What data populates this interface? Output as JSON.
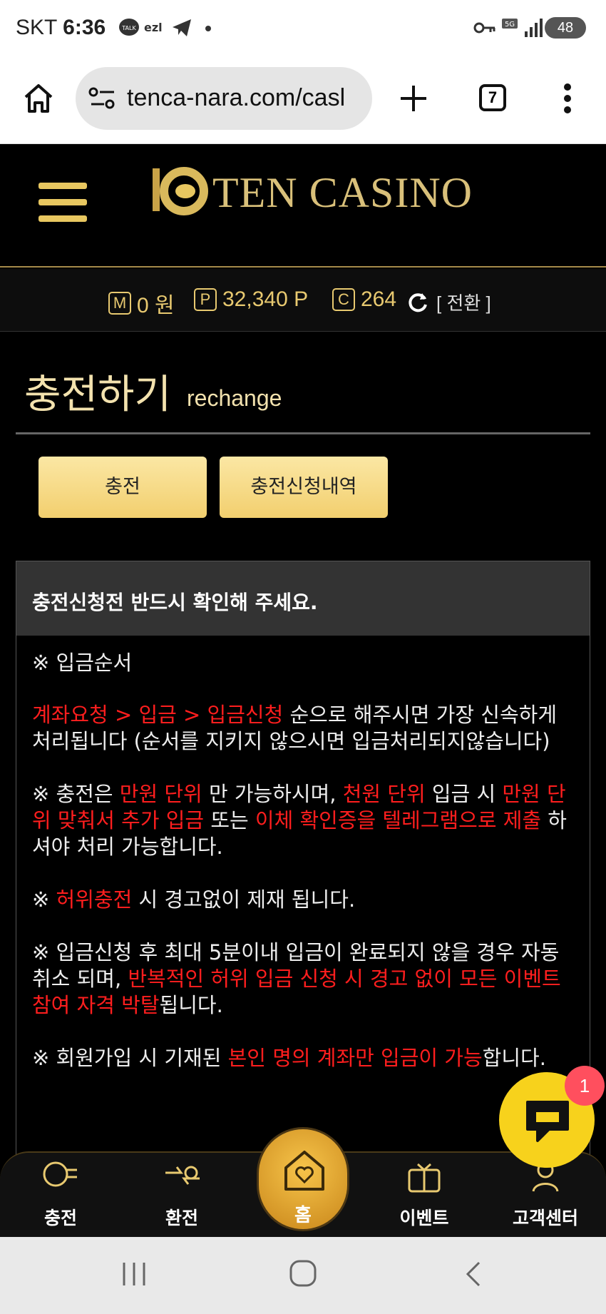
{
  "status_bar": {
    "carrier": "SKT",
    "time": "6:36",
    "battery": "48",
    "network": "5G"
  },
  "browser": {
    "url": "tenca-nara.com/casl",
    "tab_count": "7"
  },
  "header": {
    "logo_text": "TEN CASINO"
  },
  "balance": {
    "money_label": "M",
    "money_value": "0 원",
    "point_label": "P",
    "point_value": "32,340 P",
    "coin_label": "C",
    "coin_value": "264",
    "convert_label": "[ 전환 ]"
  },
  "page_title": {
    "title": "충전하기",
    "subtitle": "rechange"
  },
  "tabs": {
    "charge": "충전",
    "history": "충전신청내역"
  },
  "notice": {
    "heading": "충전신청전 반드시 확인해 주세요.",
    "deposit_order_heading": "※ 입금순서",
    "p1_red": "계좌요청 > 입금 > 입금신청",
    "p1_rest": " 순으로 해주시면 가장 신속하게 처리됩니다 (순서를 지키지 않으시면 입금처리되지않습니다)",
    "p2_a": "※ 충전은 ",
    "p2_red1": "만원 단위",
    "p2_b": " 만 가능하시며, ",
    "p2_red2": "천원 단위",
    "p2_c": " 입금 시 ",
    "p2_red3": "만원 단위 맞춰서 추가 입금",
    "p2_d": " 또는 ",
    "p2_red4": "이체 확인증을 텔레그램으로 제출",
    "p2_e": " 하셔야 처리 가능합니다.",
    "p3_a": "※ ",
    "p3_red": "허위충전",
    "p3_b": " 시 경고없이 제재 됩니다.",
    "p4_a": "※ 입금신청 후 최대 5분이내 입금이 완료되지 않을 경우 자동 취소 되며, ",
    "p4_red": "반복적인 허위 입금 신청 시 경고 없이 모든 이벤트 참여 자격 박탈",
    "p4_b": "됩니다.",
    "p5_a": "※ 회원가입 시 기재된 ",
    "p5_red": "본인 명의 계좌만 입금이 가능",
    "p5_b": "합니다."
  },
  "chat": {
    "badge": "1"
  },
  "bottom_nav": {
    "charge": "충전",
    "exchange": "환전",
    "home": "홈",
    "event": "이벤트",
    "support": "고객센터"
  },
  "colors": {
    "gold": "#e8c970",
    "button_gold": "#f6dc8c",
    "red_text": "#ff1e1e",
    "chat_yellow": "#f7d21c"
  }
}
